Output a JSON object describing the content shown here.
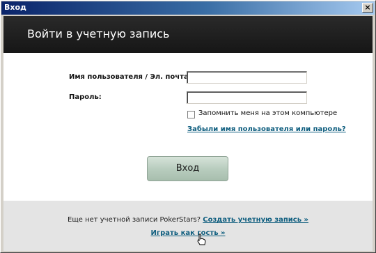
{
  "window": {
    "title": "Вход",
    "close_glyph": "×"
  },
  "header": {
    "title": "Войти в учетную запись"
  },
  "form": {
    "username_label": "Имя пользователя / Эл. почта:",
    "username_value": "",
    "password_label": "Пароль:",
    "password_value": "",
    "remember_label": "Запомнить меня на этом компьютере",
    "remember_checked": false,
    "forgot_link": "Забыли имя пользователя или пароль?",
    "login_button": "Вход"
  },
  "footer": {
    "no_account_text": "Еще нет учетной записи PokerStars?",
    "create_account_link": "Создать учетную запись »",
    "guest_link": "Играть как гость »"
  },
  "colors": {
    "link": "#0f5e7f",
    "header_bg": "#1c1c1c",
    "button_green": "#b9cdbf"
  }
}
